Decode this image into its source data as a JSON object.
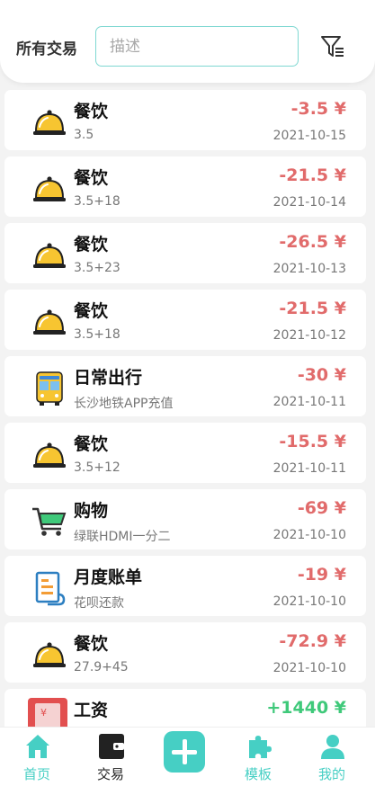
{
  "header": {
    "title": "所有交易",
    "search_placeholder": "描述",
    "search_value": ""
  },
  "colors": {
    "accent": "#46cfc4",
    "expense": "#e16b6b",
    "income": "#3fc97a",
    "meal_icon": "#f7c531"
  },
  "transactions": [
    {
      "category": "餐饮",
      "note": "3.5",
      "amount": "-3.5 ¥",
      "date": "2021-10-15",
      "icon": "food-cloche-icon",
      "type": "expense"
    },
    {
      "category": "餐饮",
      "note": "3.5+18",
      "amount": "-21.5 ¥",
      "date": "2021-10-14",
      "icon": "food-cloche-icon",
      "type": "expense"
    },
    {
      "category": "餐饮",
      "note": "3.5+23",
      "amount": "-26.5 ¥",
      "date": "2021-10-13",
      "icon": "food-cloche-icon",
      "type": "expense"
    },
    {
      "category": "餐饮",
      "note": "3.5+18",
      "amount": "-21.5 ¥",
      "date": "2021-10-12",
      "icon": "food-cloche-icon",
      "type": "expense"
    },
    {
      "category": "日常出行",
      "note": "长沙地铁APP充值",
      "amount": "-30 ¥",
      "date": "2021-10-11",
      "icon": "bus-icon",
      "type": "expense"
    },
    {
      "category": "餐饮",
      "note": "3.5+12",
      "amount": "-15.5 ¥",
      "date": "2021-10-11",
      "icon": "food-cloche-icon",
      "type": "expense"
    },
    {
      "category": "购物",
      "note": "绿联HDMI一分二",
      "amount": "-69 ¥",
      "date": "2021-10-10",
      "icon": "shopping-cart-icon",
      "type": "expense"
    },
    {
      "category": "月度账单",
      "note": "花呗还款",
      "amount": "-19 ¥",
      "date": "2021-10-10",
      "icon": "bill-icon",
      "type": "expense"
    },
    {
      "category": "餐饮",
      "note": "27.9+45",
      "amount": "-72.9 ¥",
      "date": "2021-10-10",
      "icon": "food-cloche-icon",
      "type": "expense"
    },
    {
      "category": "工资",
      "note": "",
      "amount": "+1440 ¥",
      "date": "",
      "icon": "salary-envelope-icon",
      "type": "income"
    }
  ],
  "nav": {
    "home": "首页",
    "transactions": "交易",
    "templates": "模板",
    "profile": "我的",
    "active": "transactions"
  }
}
